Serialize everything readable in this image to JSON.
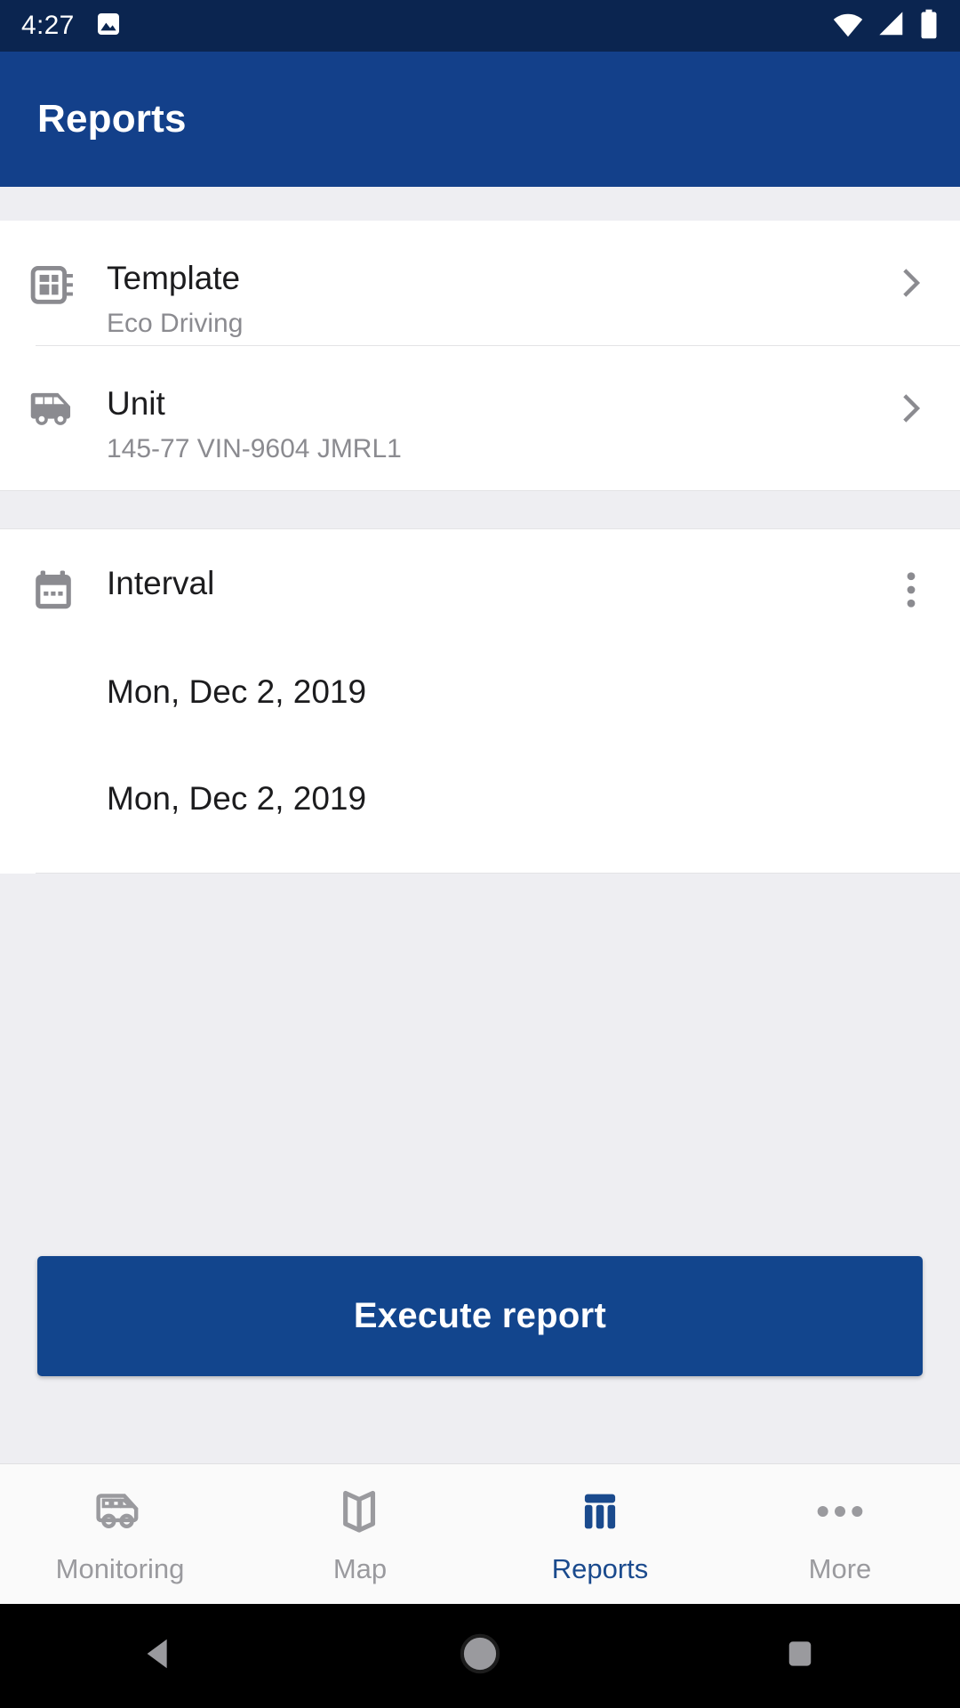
{
  "status_bar": {
    "time": "4:27",
    "left_icons": [
      "image-icon"
    ],
    "right_icons": [
      "wifi-icon",
      "cellular-signal-icon",
      "battery-icon"
    ],
    "background_color": "#0b2550"
  },
  "app_bar": {
    "title": "Reports",
    "background_color": "#13408a",
    "text_color": "#ffffff"
  },
  "rows": {
    "template": {
      "icon": "template-icon",
      "title": "Template",
      "subtitle": "Eco Driving",
      "action_icon": "chevron-right-icon"
    },
    "unit": {
      "icon": "van-icon",
      "title": "Unit",
      "subtitle": "145-77 VIN-9604  JMRL1",
      "action_icon": "chevron-right-icon"
    },
    "interval": {
      "icon": "calendar-icon",
      "title": "Interval",
      "action_icon": "overflow-menu-icon",
      "date_from": "Mon, Dec 2, 2019",
      "date_to": "Mon, Dec 2, 2019"
    }
  },
  "execute": {
    "label": "Execute report",
    "background_color": "#12458d",
    "text_color": "#ffffff"
  },
  "bottom_nav": {
    "active_color": "#1a4a8d",
    "inactive_color": "#9a9a9e",
    "items": [
      {
        "label": "Monitoring",
        "icon": "van-icon",
        "active": false
      },
      {
        "label": "Map",
        "icon": "map-icon",
        "active": false
      },
      {
        "label": "Reports",
        "icon": "reports-bar-chart-icon",
        "active": true
      },
      {
        "label": "More",
        "icon": "more-dots-icon",
        "active": false
      }
    ]
  },
  "android_nav": {
    "background_color": "#000000",
    "buttons": [
      "back-triangle-icon",
      "home-circle-icon",
      "recents-square-icon"
    ]
  }
}
